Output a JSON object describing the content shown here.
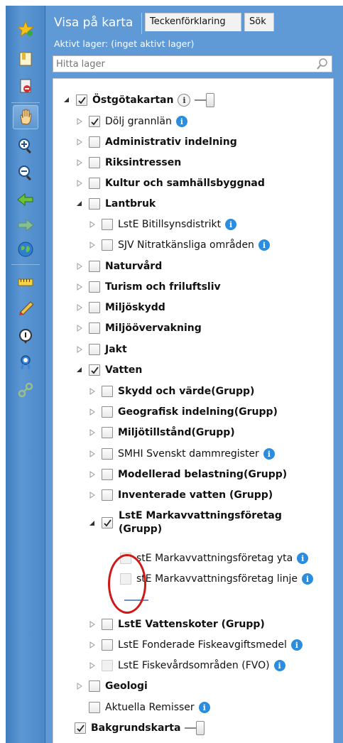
{
  "tabs": {
    "active": "Visa på karta",
    "legend": "Teckenförklaring",
    "search": "Sök"
  },
  "active_layer": "Aktivt lager: (inget aktivt lager)",
  "search_placeholder": "Hitta lager",
  "toolbar_icons": [
    "favorites-star-icon",
    "bookmark-icon",
    "clear-map-icon",
    "pan-hand-icon",
    "zoom-in-icon",
    "zoom-out-icon",
    "back-arrow-icon",
    "forward-arrow-icon",
    "full-extent-globe-icon",
    "measure-ruler-icon",
    "draw-pencil-icon",
    "identify-icon",
    "print-ribbon-icon",
    "share-link-icon"
  ],
  "tree": {
    "root": "Östgötakartan",
    "items": [
      {
        "label": "Dölj grannlän"
      },
      {
        "label": "Administrativ indelning"
      },
      {
        "label": "Riksintressen"
      },
      {
        "label": "Kultur och samhällsbyggnad"
      },
      {
        "label": "Lantbruk"
      },
      {
        "label": "LstE Bitillsynsdistrikt"
      },
      {
        "label": "SJV Nitratkänsliga områden"
      },
      {
        "label": "Naturvård"
      },
      {
        "label": "Turism och friluftsliv"
      },
      {
        "label": "Miljöskydd"
      },
      {
        "label": "Miljöövervakning"
      },
      {
        "label": "Jakt"
      },
      {
        "label": "Vatten"
      },
      {
        "label": "Skydd och värde(Grupp)"
      },
      {
        "label": "Geografisk indelning(Grupp)"
      },
      {
        "label": "Miljötillstånd(Grupp)"
      },
      {
        "label": "SMHI Svenskt dammregister"
      },
      {
        "label": "Modellerad belastning(Grupp)"
      },
      {
        "label": "Inventerade vatten (Grupp)"
      },
      {
        "label_line1": "LstE Markavvattningsföretag",
        "label_line2": "(Grupp)"
      },
      {
        "label": "stE Markavvattningsföretag yta"
      },
      {
        "label": "stE Markavvattningsföretag linje"
      },
      {
        "label": "LstE Vattenskoter (Grupp)"
      },
      {
        "label": "LstE Fonderade Fiskeavgiftsmedel"
      },
      {
        "label": "LstE Fiskevårdsområden (FVO)"
      },
      {
        "label": "Geologi"
      },
      {
        "label": "Aktuella Remisser"
      }
    ],
    "background": "Bakgrundskarta"
  },
  "colors": {
    "panel": "#5f9ad6",
    "toolbar": "#4c88c8",
    "info": "#2a8de0",
    "highlight_ring": "#d01818"
  }
}
